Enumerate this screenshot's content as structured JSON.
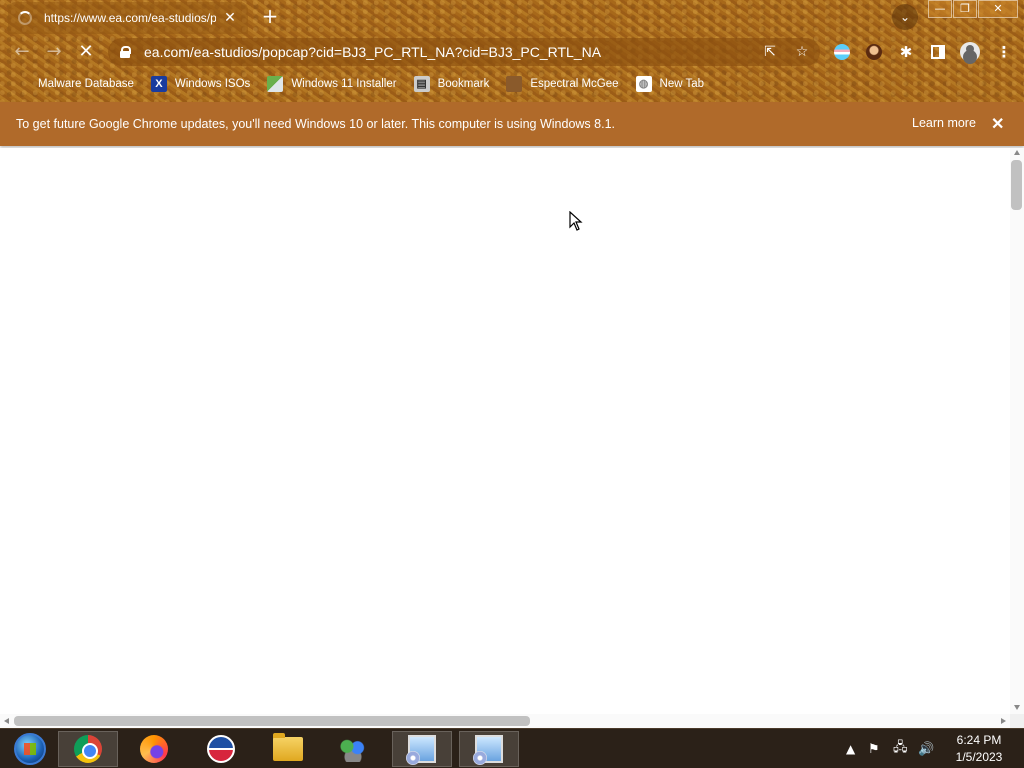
{
  "browser": {
    "tab": {
      "title": "https://www.ea.com/ea-studios/p",
      "close_icon": "close-icon",
      "loading": true
    },
    "new_tab_label": "+",
    "window_controls": {
      "minimize": "—",
      "maximize": "❐",
      "close": "✕"
    },
    "tab_search_glyph": "⌄",
    "toolbar": {
      "back_glyph": "←",
      "forward_glyph": "→",
      "stop_glyph": "✕",
      "url": "ea.com/ea-studios/popcap?cid=BJ3_PC_RTL_NA?cid=BJ3_PC_RTL_NA",
      "share_glyph": "⇱",
      "star_glyph": "☆",
      "menu_glyph": "⋮",
      "puzzle_glyph": "✱"
    },
    "bookmarks": [
      {
        "label": "Malware Database",
        "icon": "blank-icon"
      },
      {
        "label": "Windows ISOs",
        "icon": "x-logo-icon",
        "glyph": "X"
      },
      {
        "label": "Windows 11 Installer",
        "icon": "installer-icon"
      },
      {
        "label": "Bookmark",
        "icon": "document-icon",
        "glyph": "▤"
      },
      {
        "label": "Espectral McGee",
        "icon": "face-icon"
      },
      {
        "label": "New Tab",
        "icon": "globe-icon",
        "glyph": "◍"
      }
    ],
    "infobar": {
      "message": "To get future Google Chrome updates, you'll need Windows 10 or later. This computer is using Windows 8.1.",
      "learn_more": "Learn more",
      "close_glyph": "✕"
    }
  },
  "taskbar": {
    "apps": [
      {
        "name": "start-button",
        "active": false
      },
      {
        "name": "chrome",
        "active": true
      },
      {
        "name": "firefox",
        "active": false
      },
      {
        "name": "obama-app",
        "active": false
      },
      {
        "name": "file-explorer",
        "active": false
      },
      {
        "name": "messenger",
        "active": false
      },
      {
        "name": "setup-1",
        "active": false
      },
      {
        "name": "setup-2",
        "active": false
      }
    ],
    "tray": {
      "chevron": "▲",
      "flag": "⚑",
      "network": "🖧",
      "volume": "🔊"
    },
    "clock": {
      "time": "6:24 PM",
      "date": "1/5/2023"
    }
  },
  "colors": {
    "frame": "#b87520",
    "infobar": "#b06a2a",
    "taskbar": "#2b2118",
    "page": "#ffffff"
  }
}
